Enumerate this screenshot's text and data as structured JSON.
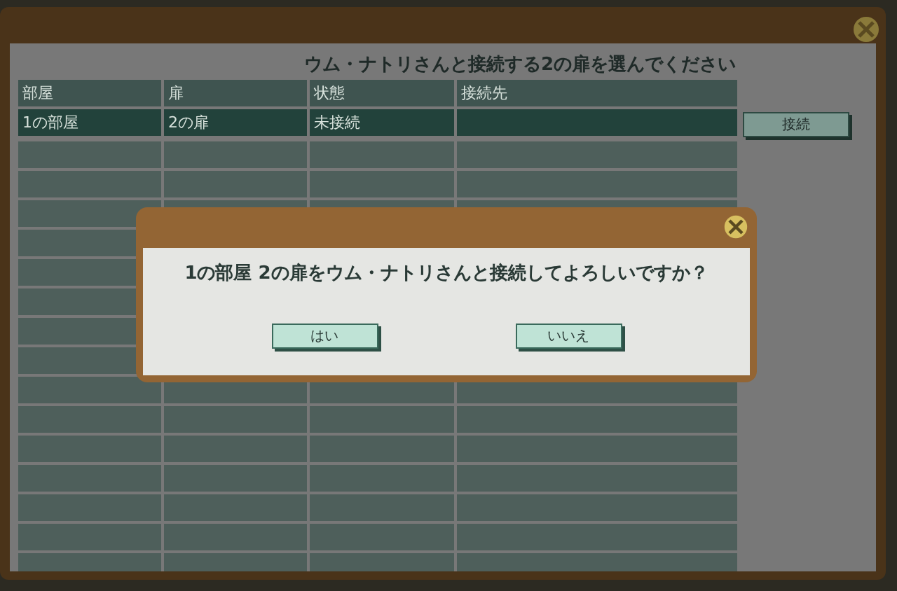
{
  "window": {
    "title": "ウム・ナトリさんと接続する2の扉を選んでください"
  },
  "table": {
    "columns": [
      "部屋",
      "扉",
      "状態",
      "接続先"
    ],
    "rows": [
      {
        "cells": [
          "1の部屋",
          "2の扉",
          "未接続",
          ""
        ],
        "selected": true
      }
    ]
  },
  "connect_button": "接続",
  "dialog": {
    "message": "1の部屋 2の扉をウム・ナトリさんと接続してよろしいですか？",
    "buttons": [
      "はい",
      "いいえ"
    ]
  }
}
